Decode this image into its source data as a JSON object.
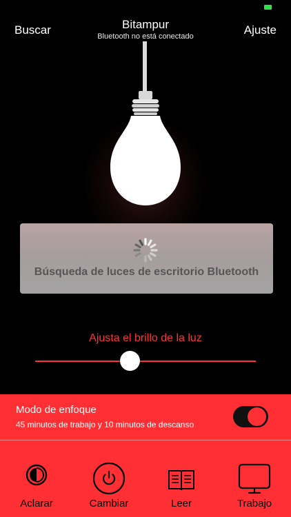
{
  "status": {
    "battery_color": "#2ee24a"
  },
  "nav": {
    "left_label": "Buscar",
    "title": "Bitampur",
    "subtitle": "Bluetooth no está conectado",
    "right_label": "Ajuste"
  },
  "scan": {
    "text": "Búsqueda de luces de escritorio Bluetooth"
  },
  "brightness": {
    "label": "Ajusta el brillo de la luz",
    "value": 0.43
  },
  "focus": {
    "title": "Modo de enfoque",
    "description": "45 minutos de trabajo y 10 minutos de descanso",
    "enabled": true
  },
  "tabs": [
    {
      "label": "Aclarar",
      "icon": "half-circle-icon"
    },
    {
      "label": "Cambiar",
      "icon": "power-icon"
    },
    {
      "label": "Leer",
      "icon": "book-icon"
    },
    {
      "label": "Trabajo",
      "icon": "monitor-icon"
    }
  ],
  "colors": {
    "accent": "#ff2f34",
    "background": "#000000"
  }
}
